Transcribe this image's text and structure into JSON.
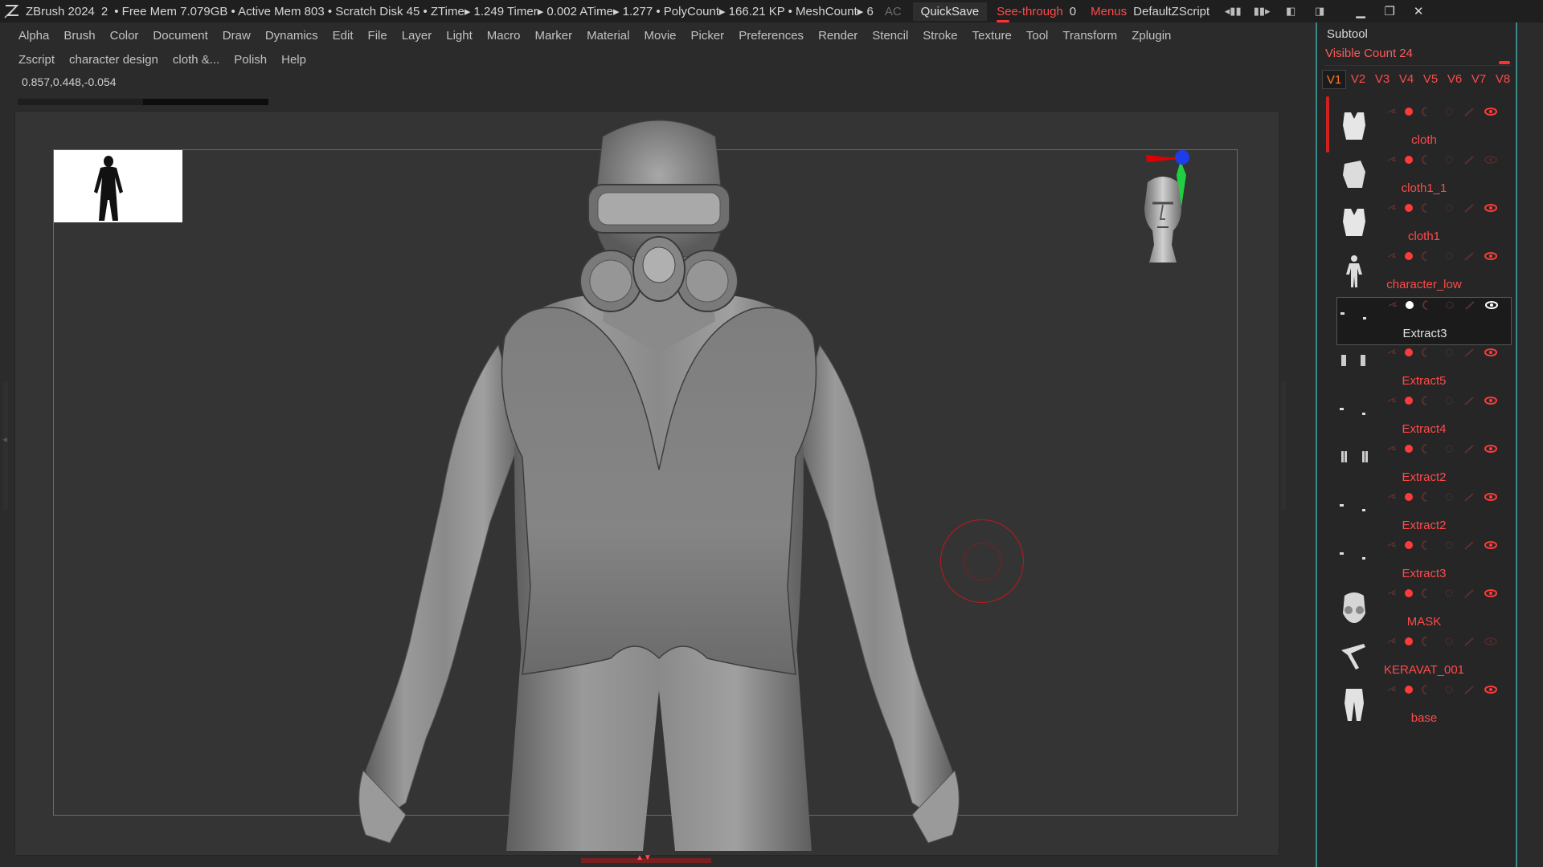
{
  "titlebar": {
    "app_name": "ZBrush 2024",
    "doc_number": "2",
    "stats": "• Free Mem 7.079GB • Active Mem 803 • Scratch Disk 45 •  ZTime▸ 1.249 Timer▸ 0.002 ATime▸ 1.277 • PolyCount▸ 166.21 KP  • MeshCount▸ 6",
    "ac": "AC",
    "quicksave": "QuickSave",
    "see_through_label": "See-through",
    "see_through_value": "0",
    "menus": "Menus",
    "script": "DefaultZScript"
  },
  "menu_row1": [
    "Alpha",
    "Brush",
    "Color",
    "Document",
    "Draw",
    "Dynamics",
    "Edit",
    "File",
    "Layer",
    "Light",
    "Macro",
    "Marker",
    "Material",
    "Movie",
    "Picker",
    "Preferences",
    "Render",
    "Stencil",
    "Stroke",
    "Texture",
    "Tool",
    "Transform",
    "Zplugin"
  ],
  "menu_row2": [
    "Zscript",
    "character design",
    "cloth &...",
    "Polish",
    "Help"
  ],
  "coords": "0.857,0.448,-0.054",
  "progress_fraction": 0.5,
  "subtool": {
    "header": "Subtool",
    "visible_count": "Visible Count 24",
    "tabs": [
      "V1",
      "V2",
      "V3",
      "V4",
      "V5",
      "V6",
      "V7",
      "V8"
    ],
    "active_tab": "V1",
    "items": [
      {
        "name": "cloth",
        "thumb": "vest-icon",
        "selected": false,
        "visible": true
      },
      {
        "name": "cloth1_1",
        "thumb": "bag-icon",
        "selected": false,
        "visible": false
      },
      {
        "name": "cloth1",
        "thumb": "vest-icon",
        "selected": false,
        "visible": true
      },
      {
        "name": "character_low",
        "thumb": "body-icon",
        "selected": false,
        "visible": true
      },
      {
        "name": "Extract3",
        "thumb": "small-parts-icon",
        "selected": true,
        "visible": true
      },
      {
        "name": "Extract5",
        "thumb": "boots-icon",
        "selected": false,
        "visible": true
      },
      {
        "name": "Extract4",
        "thumb": "small-parts-icon",
        "selected": false,
        "visible": true
      },
      {
        "name": "Extract2",
        "thumb": "legs-icon",
        "selected": false,
        "visible": true
      },
      {
        "name": "Extract2",
        "thumb": "small-parts-icon",
        "selected": false,
        "visible": true
      },
      {
        "name": "Extract3",
        "thumb": "small-parts-icon",
        "selected": false,
        "visible": true
      },
      {
        "name": "MASK",
        "thumb": "mask-icon",
        "selected": false,
        "visible": true
      },
      {
        "name": "KERAVAT_001",
        "thumb": "tie-icon",
        "selected": false,
        "visible": false
      },
      {
        "name": "base",
        "thumb": "pants-icon",
        "selected": false,
        "visible": true
      }
    ]
  },
  "colors": {
    "accent_red": "#ff4a4a",
    "panel_border": "#3a8a8a",
    "viewport_bg": "#343434"
  }
}
